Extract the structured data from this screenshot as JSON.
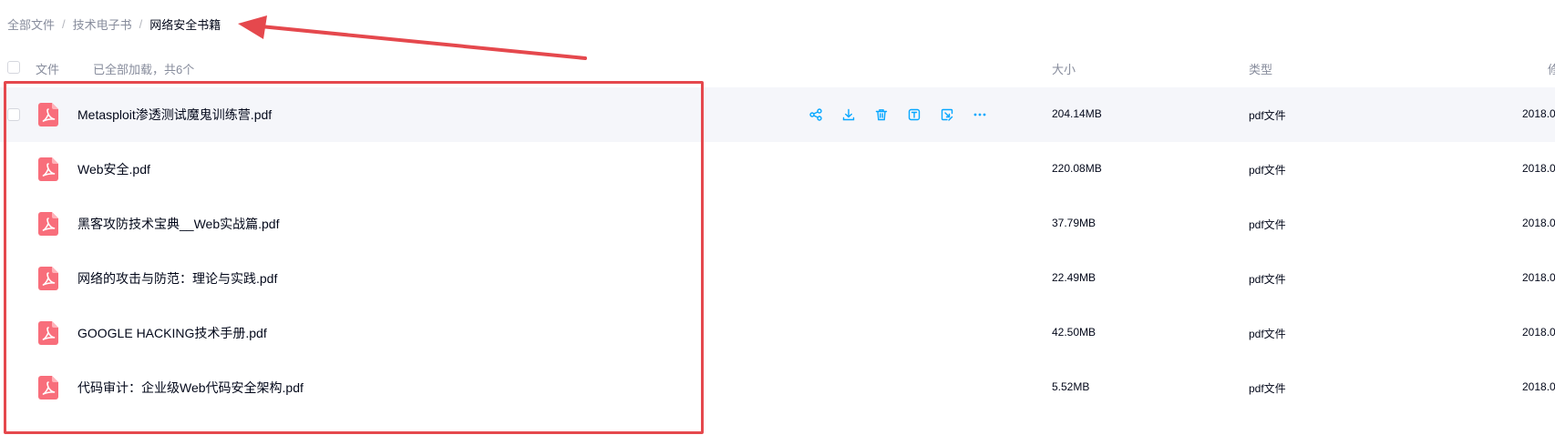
{
  "breadcrumb": {
    "items": [
      "全部文件",
      "技术电子书",
      "网络安全书籍"
    ],
    "separator": "/"
  },
  "header": {
    "file_label": "文件",
    "loaded_text": "已全部加载，共6个",
    "size_label": "大小",
    "type_label": "类型",
    "date_label": "修"
  },
  "rows": [
    {
      "name": "Metasploit渗透测试魔鬼训练营.pdf",
      "size": "204.14MB",
      "type": "pdf文件",
      "date": "2018.0"
    },
    {
      "name": "Web安全.pdf",
      "size": "220.08MB",
      "type": "pdf文件",
      "date": "2018.0"
    },
    {
      "name": "黑客攻防技术宝典__Web实战篇.pdf",
      "size": "37.79MB",
      "type": "pdf文件",
      "date": "2018.0"
    },
    {
      "name": "网络的攻击与防范：理论与实践.pdf",
      "size": "22.49MB",
      "type": "pdf文件",
      "date": "2018.0"
    },
    {
      "name": "GOOGLE HACKING技术手册.pdf",
      "size": "42.50MB",
      "type": "pdf文件",
      "date": "2018.0"
    },
    {
      "name": "代码审计：企业级Web代码安全架构.pdf",
      "size": "5.52MB",
      "type": "pdf文件",
      "date": "2018.0"
    }
  ],
  "row_actions": [
    "share-icon",
    "download-icon",
    "delete-icon",
    "rename-icon",
    "move-icon",
    "more-icon"
  ],
  "colors": {
    "accent": "#06a7ff",
    "pdf_icon": "#f86e7b",
    "annotation": "#e5484d",
    "hover_row": "#f5f6fa"
  }
}
